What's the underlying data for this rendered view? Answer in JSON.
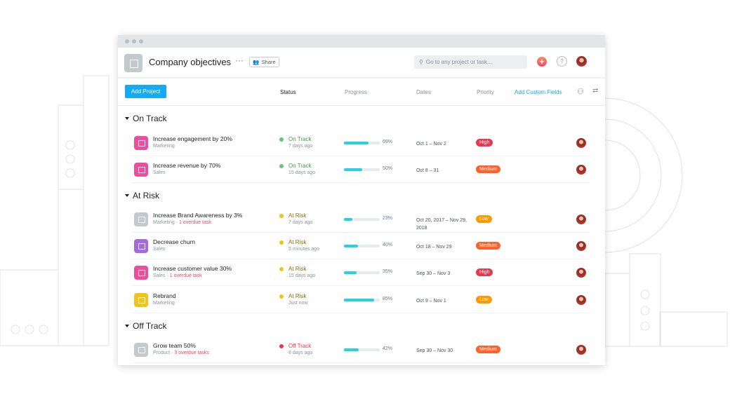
{
  "window": {
    "title": "Company objectives",
    "share_label": "Share",
    "search_placeholder": "Go to any project or task...",
    "add_icon": "plus-icon",
    "help_icon": "question-icon"
  },
  "toolbar": {
    "add_project": "Add Project",
    "columns": {
      "status": "Status",
      "progress": "Progress",
      "dates": "Dates",
      "priority": "Priority"
    },
    "add_custom_fields": "Add Custom Fields"
  },
  "colors": {
    "accent": "#14aaf5",
    "on_track": "#5fcb6c",
    "at_risk": "#f0c419",
    "off_track": "#e8384f",
    "progress": "#25d1e6",
    "high": "#e8384f",
    "medium": "#fd612c",
    "low": "#fd9a00"
  },
  "sections": [
    {
      "title": "On Track",
      "rows": [
        {
          "name": "Increase engagement by 20%",
          "team": "Marketing",
          "overdue": "",
          "icon_color": "#ea4e9d",
          "status": "On Track",
          "updated": "7 days ago",
          "progress": 69,
          "dates": "Oct 1 – Nov 2",
          "priority": "High"
        },
        {
          "name": "Increase revenue by 70%",
          "team": "Sales",
          "overdue": "",
          "icon_color": "#ea4e9d",
          "status": "On Track",
          "updated": "15 days ago",
          "progress": 50,
          "dates": "Oct 8 – 31",
          "priority": "Medium"
        }
      ]
    },
    {
      "title": "At Risk",
      "rows": [
        {
          "name": "Increase Brand Awareness by 3%",
          "team": "Marketing",
          "overdue": "1 overdue task",
          "icon_color": "#c4c9ce",
          "status": "At Risk",
          "updated": "7 days ago",
          "progress": 23,
          "dates": "Oct 20, 2017 – Nov 29, 2018",
          "priority": "Low"
        },
        {
          "name": "Decrease churn",
          "team": "Sales",
          "overdue": "",
          "icon_color": "#a46bdc",
          "status": "At Risk",
          "updated": "5 minutes ago",
          "progress": 40,
          "dates": "Oct 18 – Nov 29",
          "priority": "Medium"
        },
        {
          "name": "Increase customer value 30%",
          "team": "Sales",
          "overdue": "1 overdue task",
          "icon_color": "#ea4e9d",
          "status": "At Risk",
          "updated": "15 days ago",
          "progress": 35,
          "dates": "Sep 30 – Nov 3",
          "priority": "High"
        },
        {
          "name": "Rebrand",
          "team": "Marketing",
          "overdue": "",
          "icon_color": "#f0c419",
          "status": "At Risk",
          "updated": "Just now",
          "progress": 85,
          "dates": "Oct 9 – Nov 1",
          "priority": "Low"
        }
      ]
    },
    {
      "title": "Off Track",
      "rows": [
        {
          "name": "Grow team 50%",
          "team": "Product",
          "overdue": "3 overdue tasks",
          "icon_color": "#c4c9ce",
          "status": "Off Track",
          "updated": "8 days ago",
          "progress": 42,
          "dates": "Sep 30 – Nov 30",
          "priority": "Medium"
        }
      ]
    }
  ]
}
